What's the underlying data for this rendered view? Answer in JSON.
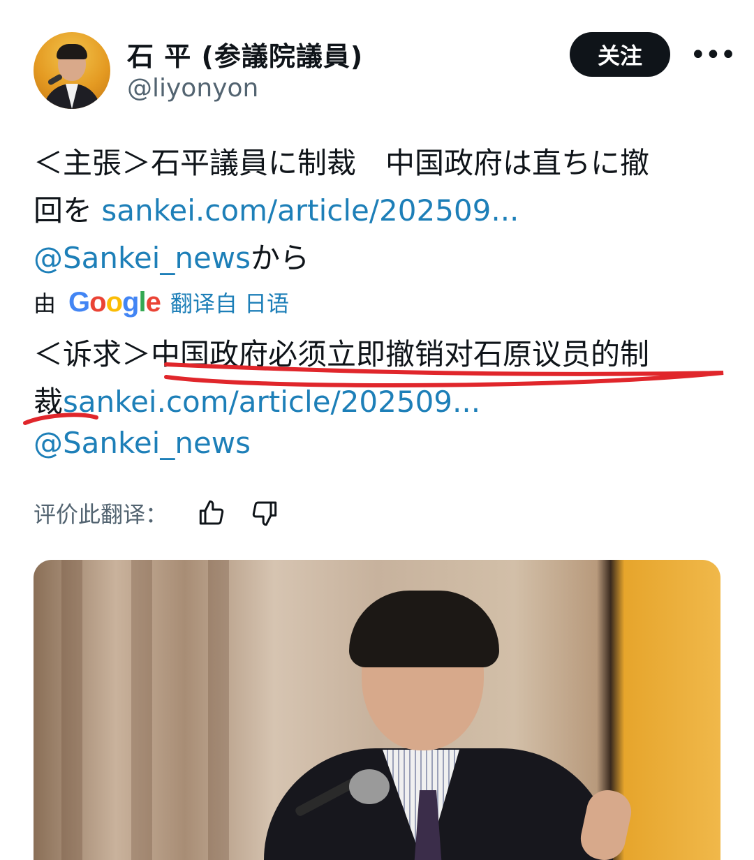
{
  "author": {
    "name": "石 平 (参議院議員)",
    "handle": "@liyonyon"
  },
  "actions": {
    "follow_label": "关注",
    "more_label": "•••"
  },
  "post": {
    "line1": "＜主張＞石平議員に制裁　中国政府は直ちに撤",
    "line2_text": "回を ",
    "line2_link": "sankei.com/article/202509...",
    "line3_link": "@Sankei_news",
    "line3_text": "から"
  },
  "translation": {
    "by": "由",
    "provider": "Google",
    "source": "翻译自 日语",
    "line1_prefix": "＜诉求＞",
    "line1_highlight": "中国政府必须立即撤销对石原议员的制",
    "line2_text": "裁",
    "line2_link": "sankei.com/article/202509...",
    "line3_link": "@Sankei_news"
  },
  "rating": {
    "label": "评价此翻译："
  },
  "colors": {
    "link": "#1d7fb8",
    "annotation": "#e0262b",
    "follow_bg": "#0f1419"
  },
  "icons": [
    "more-icon",
    "thumbs-up-icon",
    "thumbs-down-icon",
    "google-logo"
  ]
}
